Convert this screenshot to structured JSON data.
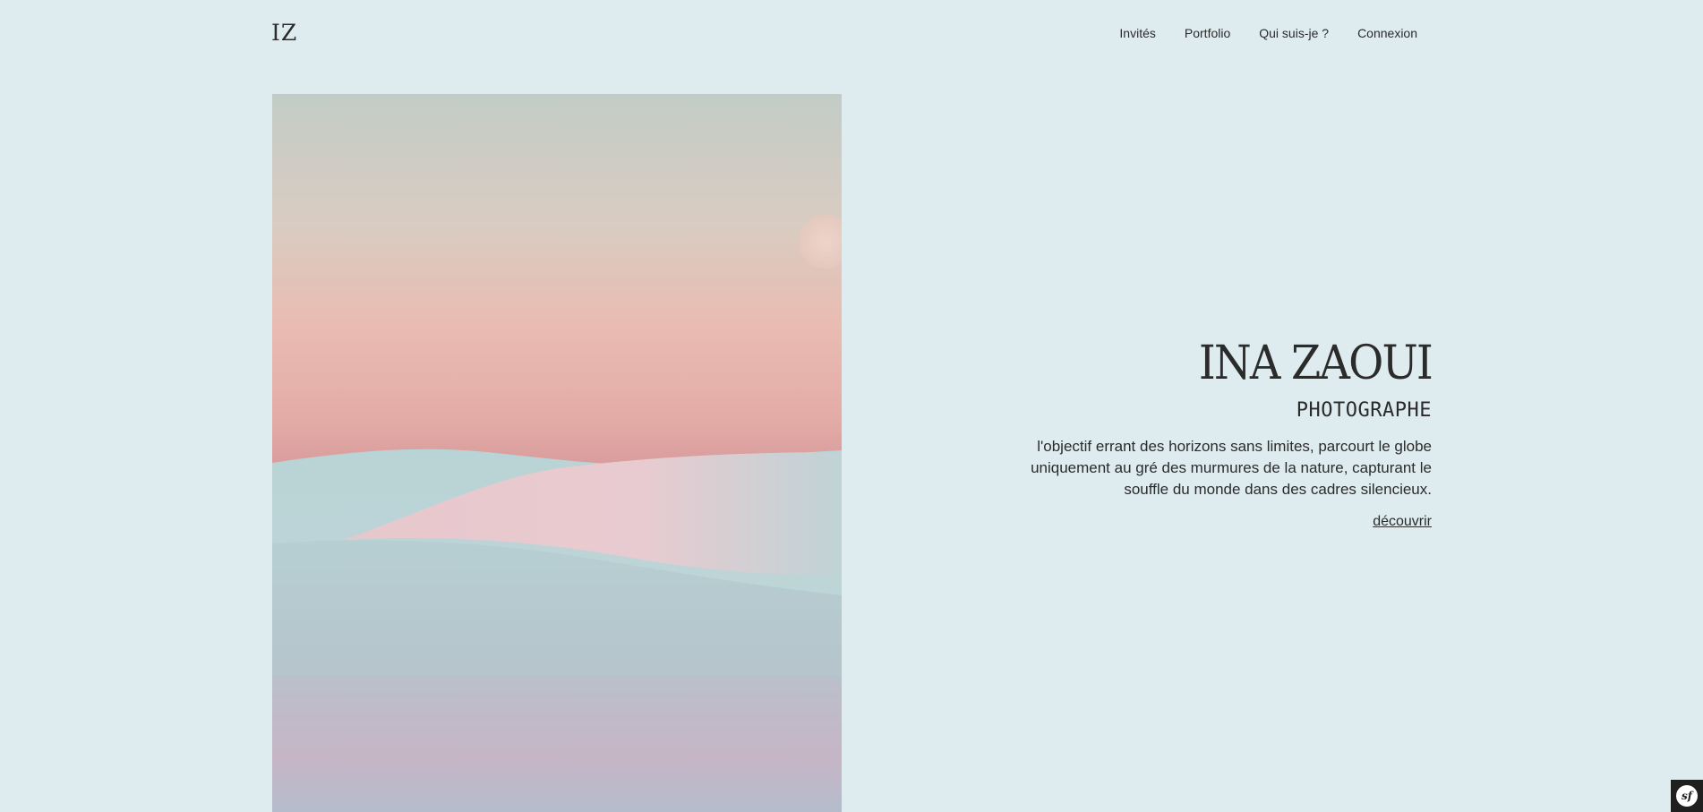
{
  "header": {
    "logo": "IZ",
    "nav": [
      {
        "label": "Invités"
      },
      {
        "label": "Portfolio"
      },
      {
        "label": "Qui suis-je ?"
      },
      {
        "label": "Connexion"
      }
    ]
  },
  "hero": {
    "image_alt": "desert-dunes-photo",
    "title": "INA ZAOUI",
    "subtitle": "PHOTOGRAPHE",
    "description": "l'objectif errant des horizons sans limites, parcourt le globe uniquement au gré des murmures de la nature, capturant le souffle du monde dans des cadres silencieux.",
    "link_label": "découvrir"
  },
  "debug_toolbar": {
    "icon": "symfony-icon",
    "label": "sf"
  },
  "colors": {
    "background": "#deecef",
    "text": "#2b2b2b",
    "sky_top": "#c2ccc6",
    "sky_mid": "#e8b8b0",
    "sky_horizon": "#dea4a2",
    "dune": "#b8d0d4"
  }
}
